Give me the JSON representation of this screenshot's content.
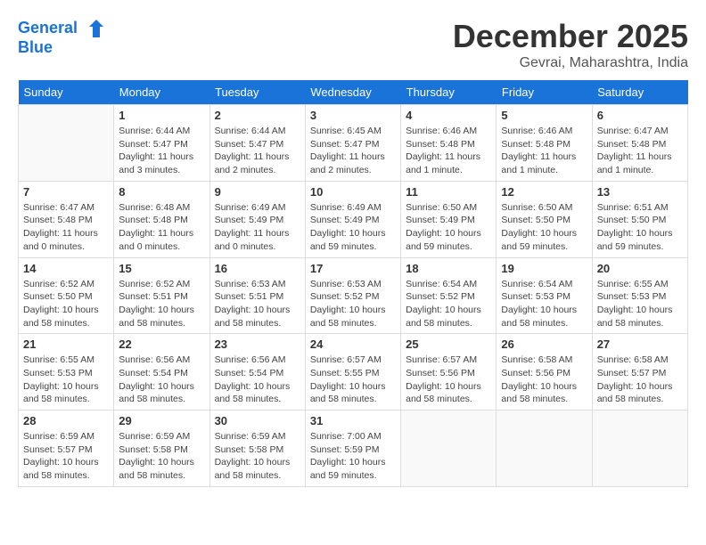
{
  "header": {
    "logo_line1": "General",
    "logo_line2": "Blue",
    "month_title": "December 2025",
    "subtitle": "Gevrai, Maharashtra, India"
  },
  "weekdays": [
    "Sunday",
    "Monday",
    "Tuesday",
    "Wednesday",
    "Thursday",
    "Friday",
    "Saturday"
  ],
  "weeks": [
    [
      {
        "day": "",
        "sunrise": "",
        "sunset": "",
        "daylight": ""
      },
      {
        "day": "1",
        "sunrise": "Sunrise: 6:44 AM",
        "sunset": "Sunset: 5:47 PM",
        "daylight": "Daylight: 11 hours and 3 minutes."
      },
      {
        "day": "2",
        "sunrise": "Sunrise: 6:44 AM",
        "sunset": "Sunset: 5:47 PM",
        "daylight": "Daylight: 11 hours and 2 minutes."
      },
      {
        "day": "3",
        "sunrise": "Sunrise: 6:45 AM",
        "sunset": "Sunset: 5:47 PM",
        "daylight": "Daylight: 11 hours and 2 minutes."
      },
      {
        "day": "4",
        "sunrise": "Sunrise: 6:46 AM",
        "sunset": "Sunset: 5:48 PM",
        "daylight": "Daylight: 11 hours and 1 minute."
      },
      {
        "day": "5",
        "sunrise": "Sunrise: 6:46 AM",
        "sunset": "Sunset: 5:48 PM",
        "daylight": "Daylight: 11 hours and 1 minute."
      },
      {
        "day": "6",
        "sunrise": "Sunrise: 6:47 AM",
        "sunset": "Sunset: 5:48 PM",
        "daylight": "Daylight: 11 hours and 1 minute."
      }
    ],
    [
      {
        "day": "7",
        "sunrise": "Sunrise: 6:47 AM",
        "sunset": "Sunset: 5:48 PM",
        "daylight": "Daylight: 11 hours and 0 minutes."
      },
      {
        "day": "8",
        "sunrise": "Sunrise: 6:48 AM",
        "sunset": "Sunset: 5:48 PM",
        "daylight": "Daylight: 11 hours and 0 minutes."
      },
      {
        "day": "9",
        "sunrise": "Sunrise: 6:49 AM",
        "sunset": "Sunset: 5:49 PM",
        "daylight": "Daylight: 11 hours and 0 minutes."
      },
      {
        "day": "10",
        "sunrise": "Sunrise: 6:49 AM",
        "sunset": "Sunset: 5:49 PM",
        "daylight": "Daylight: 10 hours and 59 minutes."
      },
      {
        "day": "11",
        "sunrise": "Sunrise: 6:50 AM",
        "sunset": "Sunset: 5:49 PM",
        "daylight": "Daylight: 10 hours and 59 minutes."
      },
      {
        "day": "12",
        "sunrise": "Sunrise: 6:50 AM",
        "sunset": "Sunset: 5:50 PM",
        "daylight": "Daylight: 10 hours and 59 minutes."
      },
      {
        "day": "13",
        "sunrise": "Sunrise: 6:51 AM",
        "sunset": "Sunset: 5:50 PM",
        "daylight": "Daylight: 10 hours and 59 minutes."
      }
    ],
    [
      {
        "day": "14",
        "sunrise": "Sunrise: 6:52 AM",
        "sunset": "Sunset: 5:50 PM",
        "daylight": "Daylight: 10 hours and 58 minutes."
      },
      {
        "day": "15",
        "sunrise": "Sunrise: 6:52 AM",
        "sunset": "Sunset: 5:51 PM",
        "daylight": "Daylight: 10 hours and 58 minutes."
      },
      {
        "day": "16",
        "sunrise": "Sunrise: 6:53 AM",
        "sunset": "Sunset: 5:51 PM",
        "daylight": "Daylight: 10 hours and 58 minutes."
      },
      {
        "day": "17",
        "sunrise": "Sunrise: 6:53 AM",
        "sunset": "Sunset: 5:52 PM",
        "daylight": "Daylight: 10 hours and 58 minutes."
      },
      {
        "day": "18",
        "sunrise": "Sunrise: 6:54 AM",
        "sunset": "Sunset: 5:52 PM",
        "daylight": "Daylight: 10 hours and 58 minutes."
      },
      {
        "day": "19",
        "sunrise": "Sunrise: 6:54 AM",
        "sunset": "Sunset: 5:53 PM",
        "daylight": "Daylight: 10 hours and 58 minutes."
      },
      {
        "day": "20",
        "sunrise": "Sunrise: 6:55 AM",
        "sunset": "Sunset: 5:53 PM",
        "daylight": "Daylight: 10 hours and 58 minutes."
      }
    ],
    [
      {
        "day": "21",
        "sunrise": "Sunrise: 6:55 AM",
        "sunset": "Sunset: 5:53 PM",
        "daylight": "Daylight: 10 hours and 58 minutes."
      },
      {
        "day": "22",
        "sunrise": "Sunrise: 6:56 AM",
        "sunset": "Sunset: 5:54 PM",
        "daylight": "Daylight: 10 hours and 58 minutes."
      },
      {
        "day": "23",
        "sunrise": "Sunrise: 6:56 AM",
        "sunset": "Sunset: 5:54 PM",
        "daylight": "Daylight: 10 hours and 58 minutes."
      },
      {
        "day": "24",
        "sunrise": "Sunrise: 6:57 AM",
        "sunset": "Sunset: 5:55 PM",
        "daylight": "Daylight: 10 hours and 58 minutes."
      },
      {
        "day": "25",
        "sunrise": "Sunrise: 6:57 AM",
        "sunset": "Sunset: 5:56 PM",
        "daylight": "Daylight: 10 hours and 58 minutes."
      },
      {
        "day": "26",
        "sunrise": "Sunrise: 6:58 AM",
        "sunset": "Sunset: 5:56 PM",
        "daylight": "Daylight: 10 hours and 58 minutes."
      },
      {
        "day": "27",
        "sunrise": "Sunrise: 6:58 AM",
        "sunset": "Sunset: 5:57 PM",
        "daylight": "Daylight: 10 hours and 58 minutes."
      }
    ],
    [
      {
        "day": "28",
        "sunrise": "Sunrise: 6:59 AM",
        "sunset": "Sunset: 5:57 PM",
        "daylight": "Daylight: 10 hours and 58 minutes."
      },
      {
        "day": "29",
        "sunrise": "Sunrise: 6:59 AM",
        "sunset": "Sunset: 5:58 PM",
        "daylight": "Daylight: 10 hours and 58 minutes."
      },
      {
        "day": "30",
        "sunrise": "Sunrise: 6:59 AM",
        "sunset": "Sunset: 5:58 PM",
        "daylight": "Daylight: 10 hours and 58 minutes."
      },
      {
        "day": "31",
        "sunrise": "Sunrise: 7:00 AM",
        "sunset": "Sunset: 5:59 PM",
        "daylight": "Daylight: 10 hours and 59 minutes."
      },
      {
        "day": "",
        "sunrise": "",
        "sunset": "",
        "daylight": ""
      },
      {
        "day": "",
        "sunrise": "",
        "sunset": "",
        "daylight": ""
      },
      {
        "day": "",
        "sunrise": "",
        "sunset": "",
        "daylight": ""
      }
    ]
  ]
}
